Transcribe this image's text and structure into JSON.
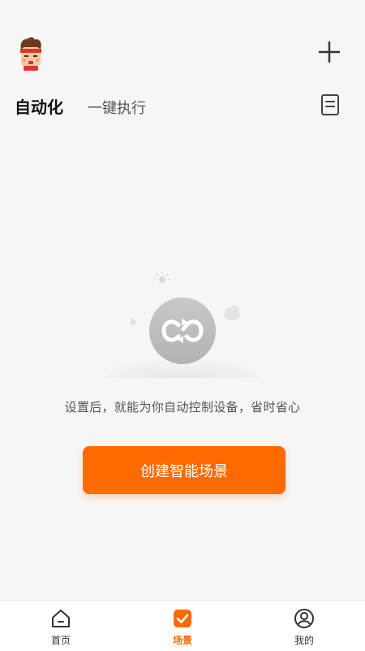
{
  "header": {
    "avatar_icon": "mascot-avatar-icon",
    "add_icon": "plus-icon",
    "log_icon": "document-log-icon"
  },
  "tabs": [
    {
      "label": "自动化",
      "active": true
    },
    {
      "label": "一键执行",
      "active": false
    }
  ],
  "empty_state": {
    "illustration_icon": "loop-sync-icon",
    "message": "设置后，就能为你自动控制设备，省时省心",
    "button_label": "创建智能场景"
  },
  "bottom_nav": [
    {
      "label": "首页",
      "icon": "home-icon",
      "active": false
    },
    {
      "label": "场景",
      "icon": "checkbox-scene-icon",
      "active": true
    },
    {
      "label": "我的",
      "icon": "user-profile-icon",
      "active": false
    }
  ],
  "colors": {
    "accent": "#ff6a00",
    "background": "#f6f6f6",
    "nav_background": "#ffffff"
  }
}
